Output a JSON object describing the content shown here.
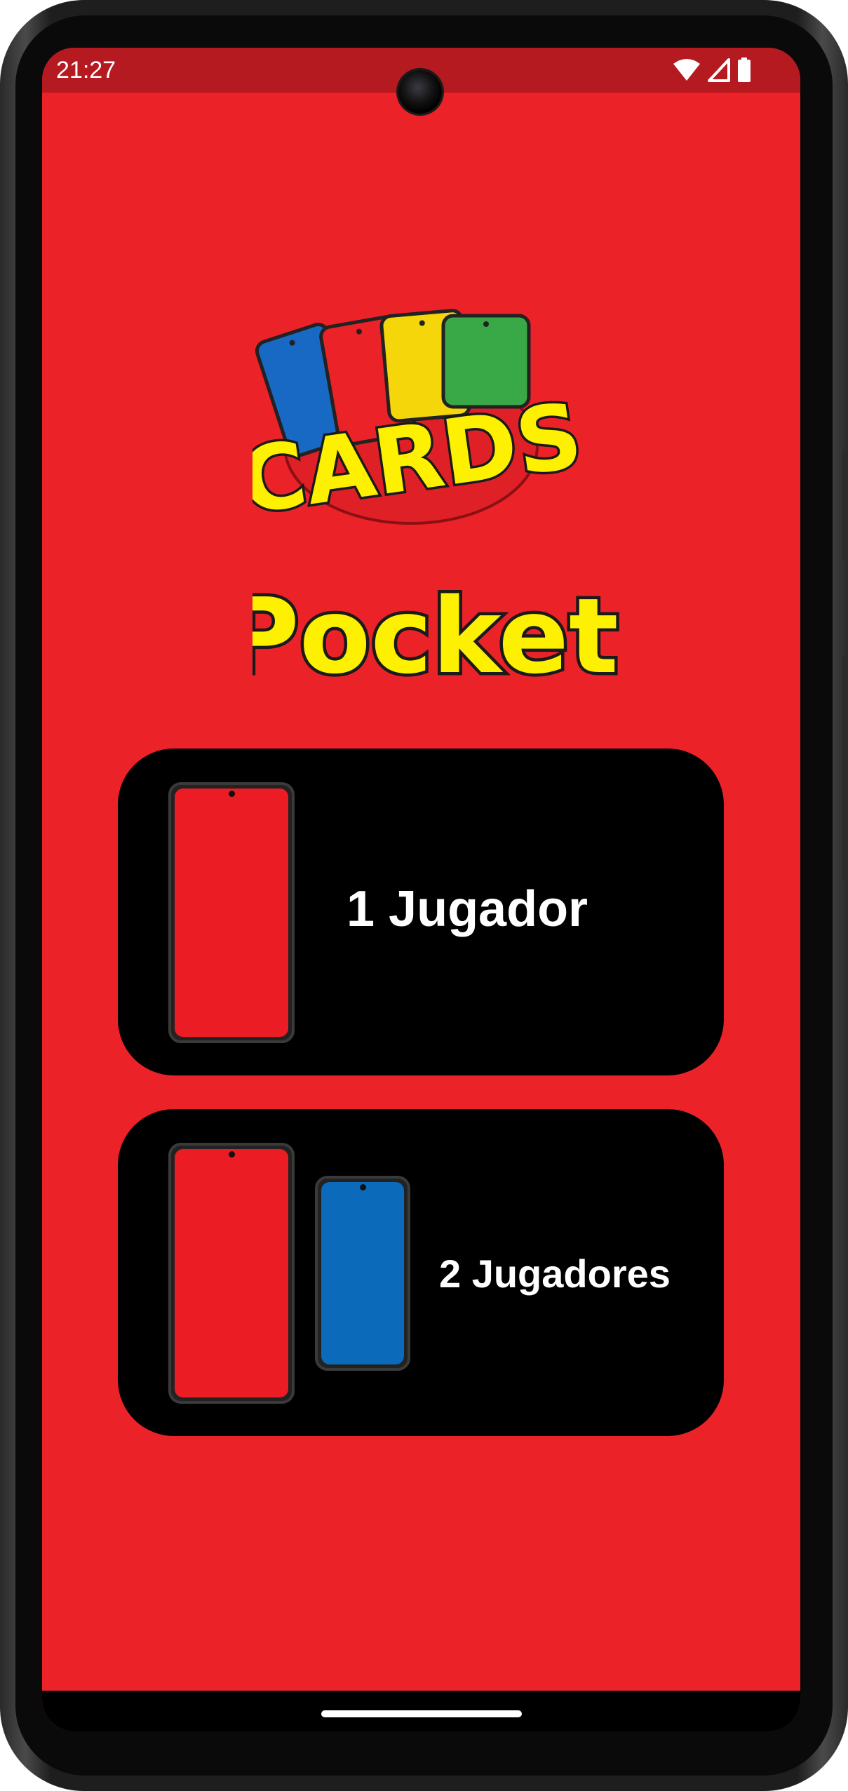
{
  "status_bar": {
    "time": "21:27",
    "icons": [
      "wifi-icon",
      "cellular-signal-icon",
      "battery-icon"
    ]
  },
  "logo": {
    "top_word": "CARDS",
    "bottom_word": "Pocket",
    "card_colors": [
      "#1769c4",
      "#ec2229",
      "#f5d60a",
      "#39a847"
    ]
  },
  "modes": [
    {
      "label": "1 Jugador",
      "phone_colors": [
        "#ec1c24"
      ]
    },
    {
      "label": "2 Jugadores",
      "phone_colors": [
        "#ec1c24",
        "#0b6ab9"
      ]
    }
  ],
  "colors": {
    "background": "#ec2229",
    "status_bar": "#b51a20",
    "card_background": "#000000",
    "label": "#ffffff"
  }
}
